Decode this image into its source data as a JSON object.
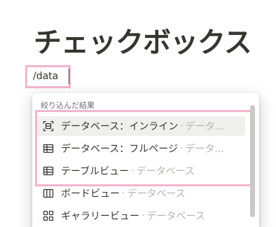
{
  "page": {
    "title": "チェックボックス"
  },
  "slash_command": {
    "value": "/data"
  },
  "menu": {
    "header": "絞り込んだ結果",
    "items": [
      {
        "icon": "inline-database-icon",
        "label": "データベース：インライン",
        "separator": "·",
        "sub": "データ..."
      },
      {
        "icon": "table-icon",
        "label": "データベース：フルページ",
        "separator": "·",
        "sub": "データ..."
      },
      {
        "icon": "table-icon",
        "label": "テーブルビュー",
        "separator": "·",
        "sub": "データベース"
      },
      {
        "icon": "board-icon",
        "label": "ボードビュー",
        "separator": "·",
        "sub": "データベース"
      },
      {
        "icon": "gallery-icon",
        "label": "ギャラリービュー",
        "separator": "·",
        "sub": "データベース"
      }
    ]
  }
}
